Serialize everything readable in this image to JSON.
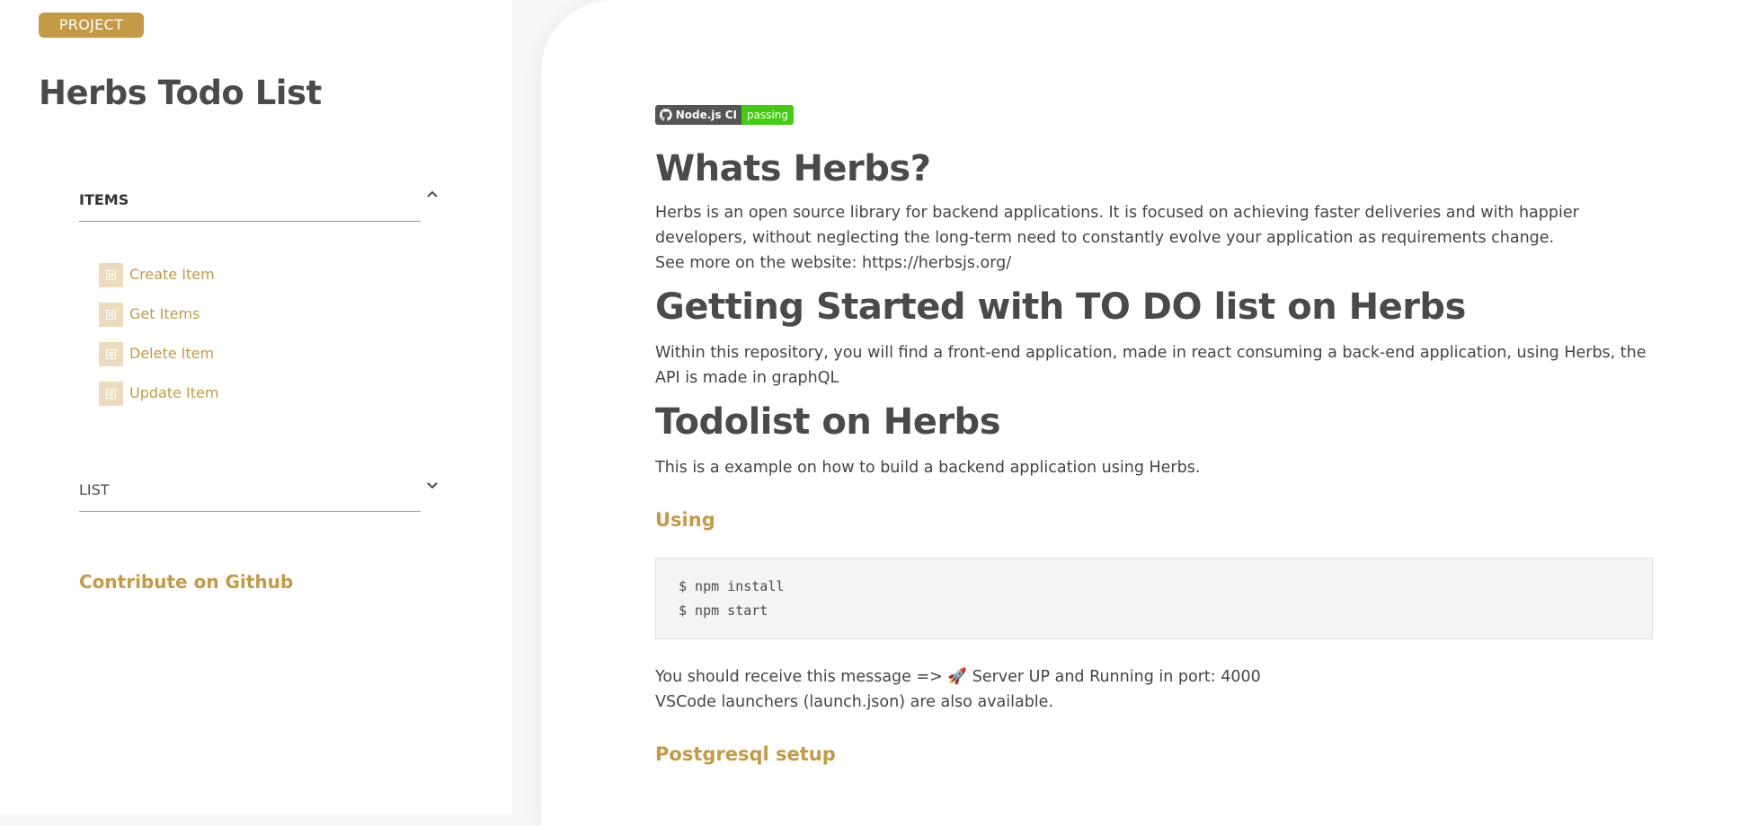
{
  "sidebar": {
    "badge": "PROJECT",
    "title": "Herbs Todo List",
    "sections": [
      {
        "label": "ITEMS",
        "expanded": true,
        "items": [
          {
            "label": "Create Item"
          },
          {
            "label": "Get Items"
          },
          {
            "label": "Delete Item"
          },
          {
            "label": "Update Item"
          }
        ]
      },
      {
        "label": "LIST",
        "expanded": false
      }
    ],
    "contribute_link": "Contribute on Github"
  },
  "content": {
    "ci_badge": {
      "left": "Node.js CI",
      "right": "passing"
    },
    "whats_title": "Whats Herbs?",
    "whats_text_1": "Herbs is an open source library for backend applications. It is focused on achieving faster deliveries and with happier developers, without neglecting the long-term need to constantly evolve your application as requirements change.",
    "whats_text_2": "See more on the website: https://herbsjs.org/",
    "getting_title": "Getting Started with TO DO list on Herbs",
    "getting_text": "Within this repository, you will find a front-end application, made in react consuming a back-end application, using Herbs, the API is made in graphQL",
    "todolist_title": "Todolist on Herbs",
    "todolist_text": "This is a example on how to build a backend application using Herbs.",
    "using_title": "Using",
    "code_lines": [
      "$ npm install",
      "$ npm start"
    ],
    "receive_text": "You should receive this message => 🚀 Server UP and Running in port: 4000",
    "launchers_text": "VSCode launchers (launch.json) are also available.",
    "postgres_title": "Postgresql setup"
  },
  "colors": {
    "accent": "#c49a45",
    "item_icon_bg": "#ecdcbd",
    "text": "#4a4a4a",
    "badge_green": "#44cc11",
    "badge_gray": "#555555"
  },
  "icons": {
    "section_expanded": "chevron-up-icon",
    "section_collapsed": "chevron-down-icon",
    "item": "document-icon",
    "ci": "github-icon"
  }
}
